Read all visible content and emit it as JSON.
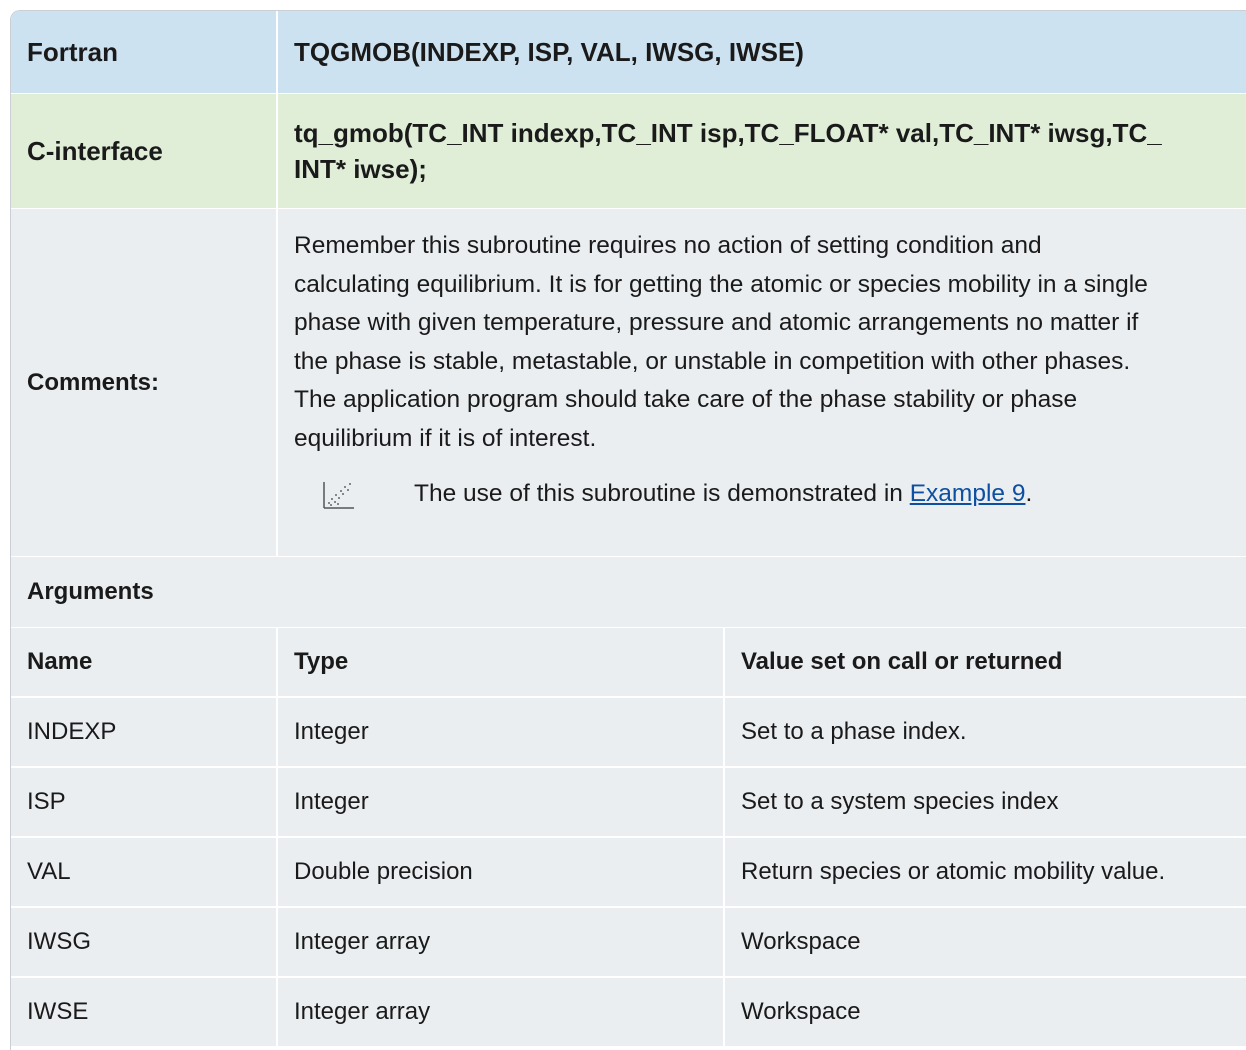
{
  "fortran": {
    "label": "Fortran",
    "signature": "TQGMOB(INDEXP, ISP, VAL, IWSG, IWSE)"
  },
  "c_interface": {
    "label": "C-interface",
    "signature_line1": "tq_gmob(TC_INT indexp,TC_INT isp,TC_FLOAT* val,TC_INT* iwsg,TC_",
    "signature_line2": "INT* iwse);"
  },
  "comments": {
    "label": "Comments:",
    "lines": [
      "Remember this subroutine requires no action of setting condition and",
      "calculating equilibrium. It is for getting the atomic or species mobility in a single",
      "phase with given temperature, pressure and atomic arrangements no matter if",
      "the phase is stable, metastable, or unstable in competition with other phases.",
      "The application program should take care of the phase stability or phase",
      "equilibrium if it is of interest."
    ],
    "note_prefix": "The use of this subroutine is demonstrated in ",
    "note_link": "Example 9",
    "note_suffix": ".",
    "note_icon": "scatter-plot-icon"
  },
  "arguments": {
    "label": "Arguments",
    "headers": {
      "name": "Name",
      "type": "Type",
      "value": "Value set on call or returned"
    },
    "rows": [
      {
        "name": "INDEXP",
        "type": "Integer",
        "value": "Set to a phase index."
      },
      {
        "name": "ISP",
        "type": "Integer",
        "value": "Set to a system species index"
      },
      {
        "name": "VAL",
        "type": "Double precision",
        "value": "Return species or atomic mobility value."
      },
      {
        "name": "IWSG",
        "type": "Integer array",
        "value": "Workspace"
      },
      {
        "name": "IWSE",
        "type": "Integer array",
        "value": "Workspace"
      }
    ]
  },
  "colors": {
    "fortran_bg": "#cde2f1",
    "c_interface_bg": "#e0edd7",
    "body_bg": "#eaeef1",
    "link": "#0d4fa0"
  }
}
